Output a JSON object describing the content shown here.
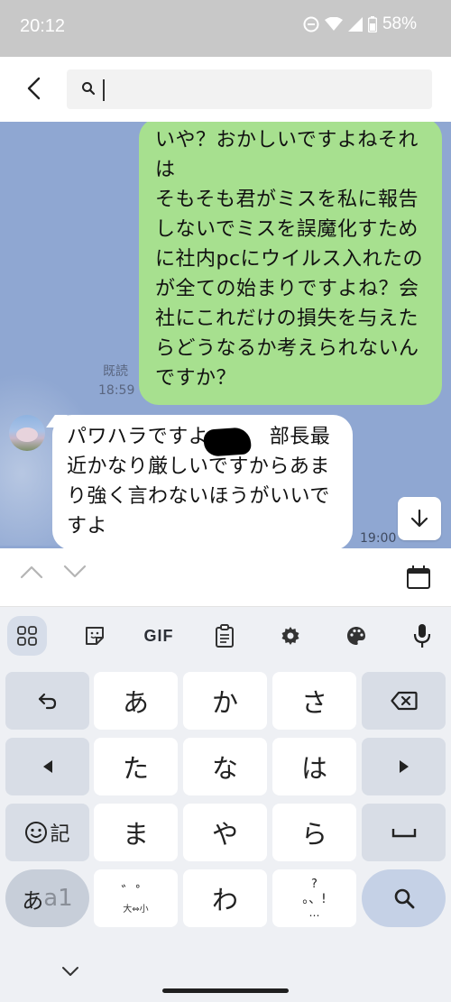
{
  "status_bar": {
    "time": "20:12",
    "battery": "58%"
  },
  "search": {
    "value": "",
    "placeholder": ""
  },
  "chat": {
    "outgoing": {
      "text": "いや？おかしいですよねそれは\nそもそも君がミスを私に報告しないでミスを誤魔化すために社内pcにウイルス入れたのが全ての始まりですよね？会社にこれだけの損失を与えたらどうなるか考えられないんですか？",
      "read_label": "既読",
      "time": "18:59",
      "color": "#a7e08f"
    },
    "incoming": {
      "text": "パワハラですよ　　　部長最近かなり厳しいですからあまり強く言わないほうがいいですよ",
      "time": "19:00"
    },
    "background_color": "#8fa7d2"
  },
  "keyboard": {
    "toolbar": {
      "gif_label": "GIF"
    },
    "rows": [
      [
        "undo",
        "あ",
        "か",
        "さ",
        "backspace"
      ],
      [
        "left",
        "た",
        "な",
        "は",
        "right"
      ],
      [
        "emoji",
        "ま",
        "や",
        "ら",
        "space"
      ],
      [
        "mode",
        "modifier",
        "わ",
        "punct",
        "search"
      ]
    ],
    "keys": {
      "a": "あ",
      "ka": "か",
      "sa": "さ",
      "ta": "た",
      "na": "な",
      "ha": "は",
      "ma": "ま",
      "ya": "や",
      "ra": "ら",
      "wa": "わ",
      "emoji_label": "記",
      "mode_label_a": "あ",
      "mode_label_b": "a1",
      "modifier_top": "゛゜",
      "modifier_bottom": "大⇔小",
      "punct_top": "?",
      "punct_mid": "。、!",
      "punct_bottom": "…"
    }
  }
}
